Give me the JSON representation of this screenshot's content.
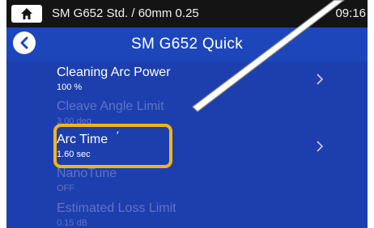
{
  "status_bar": {
    "title": "SM G652 Std. / 60mm 0.25",
    "time": "09:16"
  },
  "header": {
    "title": "SM G652 Quick"
  },
  "items": [
    {
      "label": "Cleaning Arc Power",
      "value": "100 %",
      "enabled": true,
      "has_arrow": true
    },
    {
      "label": "Cleave Angle Limit",
      "value": "3.00 deg",
      "enabled": false,
      "has_arrow": false
    },
    {
      "label": "Arc Time",
      "value": "1.60 sec",
      "enabled": true,
      "has_arrow": true,
      "edit_mark": "′"
    },
    {
      "label": "NanoTune",
      "value": "OFF",
      "enabled": false,
      "has_arrow": false
    },
    {
      "label": "Estimated Loss Limit",
      "value": "0.15 dB",
      "enabled": false,
      "has_arrow": false
    }
  ],
  "icons": {
    "home": "home-icon",
    "back": "back-arrow-icon",
    "chevron": "chevron-right-icon"
  },
  "colors": {
    "background": "#1d3fae",
    "status_bar": "#141414",
    "highlight": "#f4b41a",
    "disabled_text": "#5c73c8"
  }
}
